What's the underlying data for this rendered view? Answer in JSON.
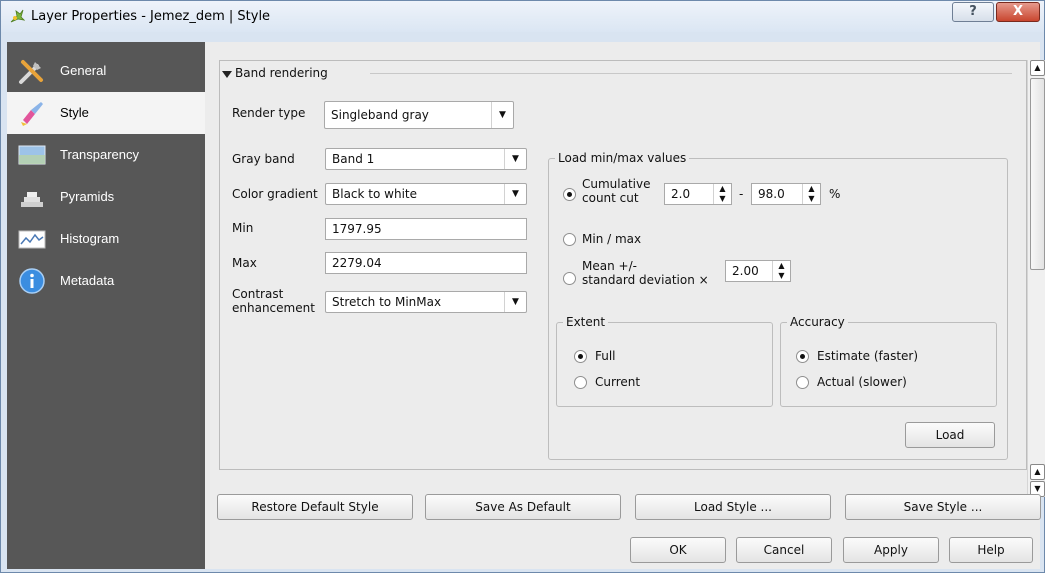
{
  "window": {
    "title": "Layer Properties - Jemez_dem | Style",
    "help_glyph": "?",
    "close_glyph": "X"
  },
  "sidebar": {
    "items": [
      {
        "label": "General",
        "icon": "tools-icon"
      },
      {
        "label": "Style",
        "icon": "paint-brush-icon",
        "active": true
      },
      {
        "label": "Transparency",
        "icon": "transparency-icon"
      },
      {
        "label": "Pyramids",
        "icon": "pyramids-icon"
      },
      {
        "label": "Histogram",
        "icon": "histogram-icon"
      },
      {
        "label": "Metadata",
        "icon": "info-icon"
      }
    ]
  },
  "band_rendering": {
    "title": "Band rendering",
    "render_type_label": "Render type",
    "render_type_value": "Singleband gray",
    "gray_band_label": "Gray band",
    "gray_band_value": "Band 1",
    "color_gradient_label": "Color gradient",
    "color_gradient_value": "Black to white",
    "min_label": "Min",
    "min_value": "1797.95",
    "max_label": "Max",
    "max_value": "2279.04",
    "contrast_label_1": "Contrast",
    "contrast_label_2": "enhancement",
    "contrast_value": "Stretch to MinMax"
  },
  "minmax": {
    "title": "Load min/max values",
    "cumulative_label_1": "Cumulative",
    "cumulative_label_2": "count cut",
    "cumulative_low": "2.0",
    "cumulative_dash": "-",
    "cumulative_high": "98.0",
    "cumulative_unit": "%",
    "minmax_label": "Min / max",
    "mean_label_1": "Mean +/-",
    "mean_label_2": "standard deviation ×",
    "mean_value": "2.00",
    "selected": "cumulative",
    "extent": {
      "title": "Extent",
      "full": "Full",
      "current": "Current",
      "selected": "full"
    },
    "accuracy": {
      "title": "Accuracy",
      "estimate": "Estimate (faster)",
      "actual": "Actual (slower)",
      "selected": "estimate"
    },
    "load_label": "Load"
  },
  "style_buttons": {
    "restore": "Restore Default Style",
    "save_default": "Save As Default",
    "load_style": "Load Style ...",
    "save_style": "Save Style ..."
  },
  "dialog_buttons": {
    "ok": "OK",
    "cancel": "Cancel",
    "apply": "Apply",
    "help": "Help"
  },
  "colors": {
    "sidebar_bg": "#575757",
    "active_item_bg": "#f4f4f4",
    "titlebar": "#dbe6f3",
    "close": "#c9462f"
  }
}
